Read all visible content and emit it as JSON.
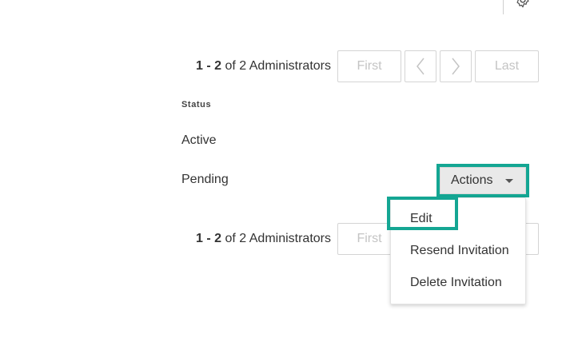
{
  "icons": {
    "settings": "gear-icon",
    "previous": "chevron-left-icon",
    "next": "chevron-right-icon",
    "dropdown": "caret-down-icon"
  },
  "colors": {
    "highlight": "#14a693",
    "disabled_text": "#c4c4c4"
  },
  "pagination_top": {
    "range": "1 - 2",
    "suffix": " of 2 Administrators",
    "first": "First",
    "last": "Last"
  },
  "table": {
    "header_status": "Status",
    "rows": [
      {
        "status": "Active"
      },
      {
        "status": "Pending",
        "actions_label": "Actions"
      }
    ]
  },
  "actions_menu": {
    "items": [
      "Edit",
      "Resend Invitation",
      "Delete Invitation"
    ]
  },
  "pagination_bottom": {
    "range": "1 - 2",
    "suffix": " of 2 Administrators",
    "first": "First"
  }
}
